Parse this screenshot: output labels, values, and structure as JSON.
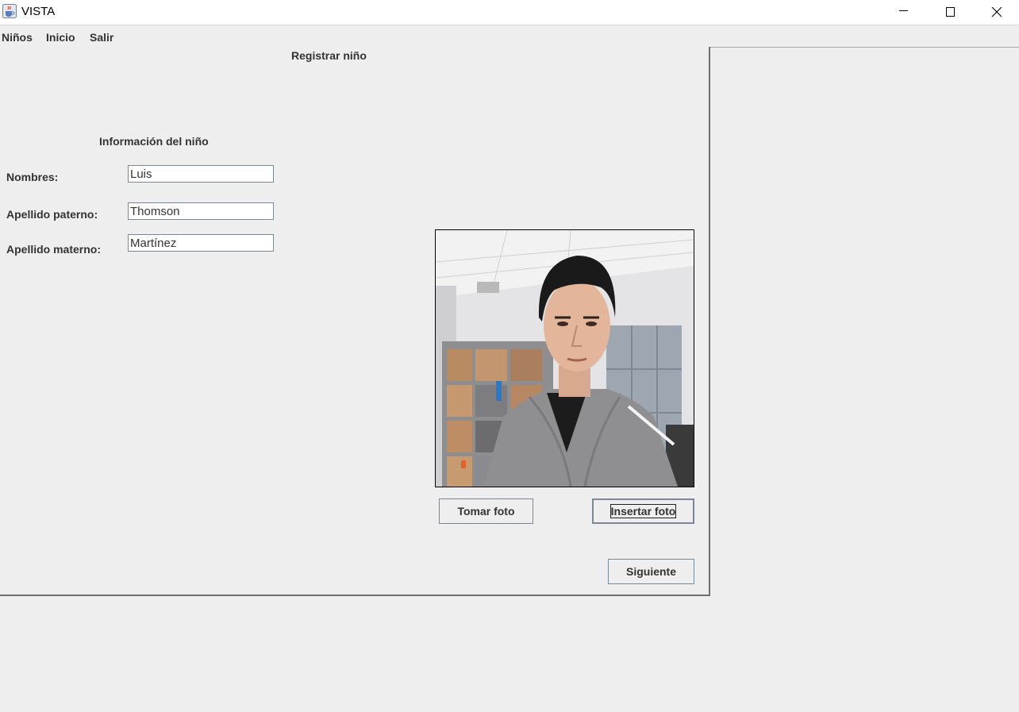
{
  "window": {
    "title": "VISTA",
    "app_icon": "java-coffee-cup-icon",
    "controls": [
      "minimize-icon",
      "maximize-icon",
      "close-icon"
    ]
  },
  "menu": {
    "items": [
      {
        "label": "Niños"
      },
      {
        "label": "Inicio"
      },
      {
        "label": "Salir"
      }
    ]
  },
  "panel": {
    "heading": "Registrar niño",
    "section_title": "Información del niño"
  },
  "form": {
    "nombres": {
      "label": "Nombres:",
      "value": "Luis"
    },
    "apellido_paterno": {
      "label": "Apellido paterno:",
      "value": "Thomson"
    },
    "apellido_materno": {
      "label": "Apellido materno:",
      "value": "Martínez"
    }
  },
  "photo": {
    "content": "webcam-photo"
  },
  "buttons": {
    "tomar_foto": "Tomar foto",
    "insertar_foto": "Insertar foto",
    "siguiente": "Siguiente"
  },
  "colors": {
    "background": "#eeeeee",
    "border": "#7a8799",
    "text": "#333333"
  }
}
